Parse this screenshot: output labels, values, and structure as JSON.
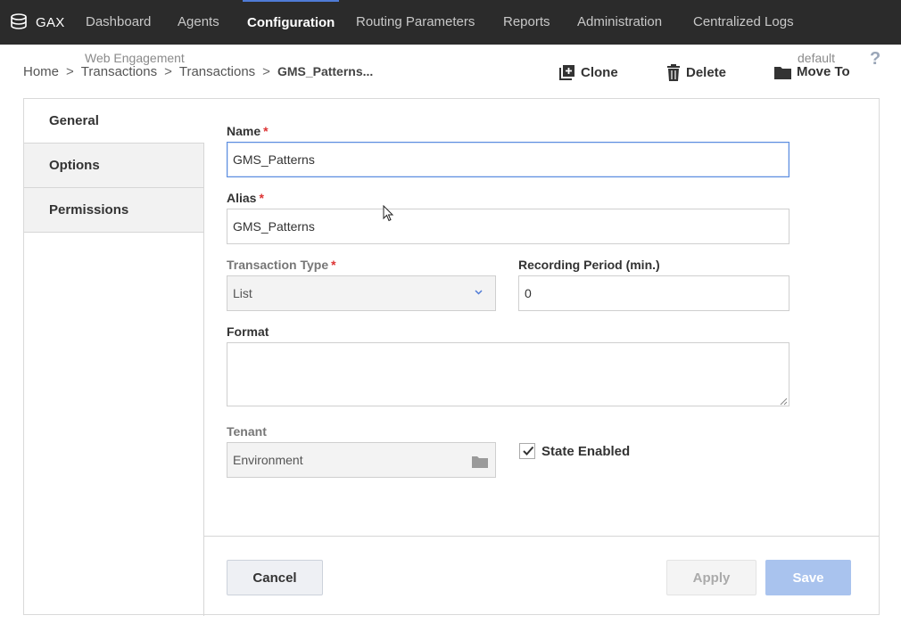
{
  "app": {
    "name": "GAX"
  },
  "nav": {
    "items": [
      {
        "label": "Dashboard",
        "active": false
      },
      {
        "label": "Agents",
        "active": false
      },
      {
        "label": "Configuration",
        "active": true
      },
      {
        "label": "Routing Parameters",
        "active": false
      },
      {
        "label": "Reports",
        "active": false
      },
      {
        "label": "Administration",
        "active": false
      },
      {
        "label": "Centralized Logs",
        "active": false
      }
    ]
  },
  "header": {
    "context_left": "Web Engagement",
    "context_right": "default",
    "help": "?"
  },
  "breadcrumb": {
    "items": [
      "Home",
      "Transactions",
      "Transactions"
    ],
    "current": "GMS_Patterns...",
    "separator": ">"
  },
  "actions": {
    "clone": "Clone",
    "delete": "Delete",
    "move_to": "Move To"
  },
  "tabs": [
    {
      "label": "General",
      "active": true
    },
    {
      "label": "Options",
      "active": false
    },
    {
      "label": "Permissions",
      "active": false
    }
  ],
  "form": {
    "required_mark": "*",
    "name": {
      "label": "Name",
      "value": "GMS_Patterns"
    },
    "alias": {
      "label": "Alias",
      "value": "GMS_Patterns"
    },
    "transaction_type": {
      "label": "Transaction Type",
      "value": "List"
    },
    "recording_period": {
      "label": "Recording Period (min.)",
      "value": "0"
    },
    "format": {
      "label": "Format",
      "value": ""
    },
    "tenant": {
      "label": "Tenant",
      "value": "Environment"
    },
    "state_enabled": {
      "label": "State Enabled",
      "checked": true
    }
  },
  "buttons": {
    "cancel": "Cancel",
    "apply": "Apply",
    "save": "Save"
  },
  "colors": {
    "topbar": "#2b2b2b",
    "accent": "#4f7bd6",
    "required": "#dd3333",
    "save_disabled": "#a9c3ee"
  }
}
